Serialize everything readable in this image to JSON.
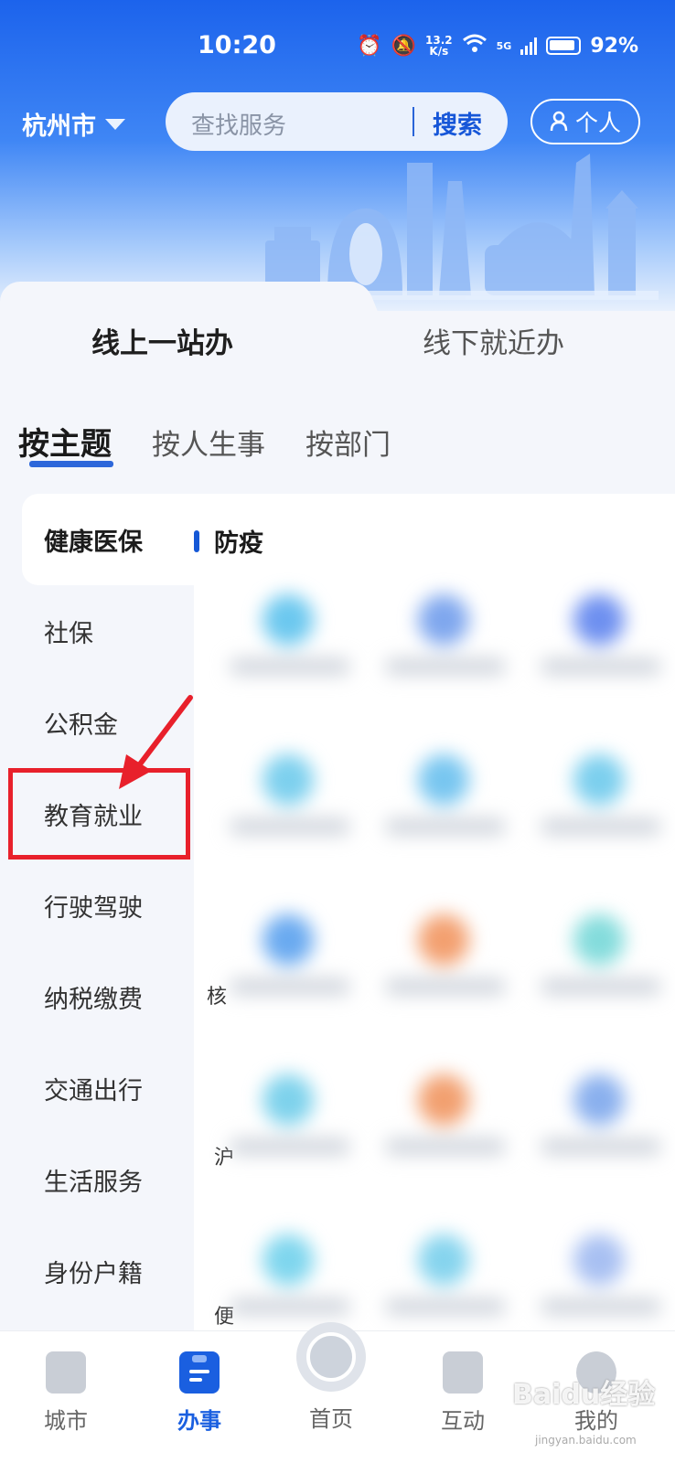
{
  "status_bar": {
    "time": "10:20",
    "speed_value": "13.2",
    "speed_unit": "K/s",
    "network": "5G",
    "battery": "92%"
  },
  "header": {
    "city": "杭州市",
    "search_placeholder": "查找服务",
    "search_button": "搜索",
    "personal_button": "个人"
  },
  "service_tabs": [
    {
      "label": "线上一站办",
      "active": true
    },
    {
      "label": "线下就近办",
      "active": false
    }
  ],
  "category_tabs": [
    {
      "label": "按主题",
      "active": true
    },
    {
      "label": "按人生事",
      "active": false
    },
    {
      "label": "按部门",
      "active": false
    }
  ],
  "side_menu": [
    {
      "label": "健康医保",
      "active": true
    },
    {
      "label": "社保"
    },
    {
      "label": "公积金"
    },
    {
      "label": "教育就业",
      "highlighted": true
    },
    {
      "label": "行驶驾驶"
    },
    {
      "label": "纳税缴费"
    },
    {
      "label": "交通出行"
    },
    {
      "label": "生活服务"
    },
    {
      "label": "身份户籍"
    }
  ],
  "content": {
    "section_title": "防疫",
    "partial_labels": [
      "核",
      "沪",
      "便"
    ]
  },
  "icon_colors": [
    "#6cc8ef",
    "#7fa7ee",
    "#6e90f0",
    "#7dd0ee",
    "#78c6f0",
    "#7ccfee",
    "#6aaaf0",
    "#f3a070",
    "#84dcdc",
    "#7ed2ec",
    "#f2a070",
    "#8ab0ee",
    "#7fd6ee",
    "#86d4ee",
    "#a8c0f2"
  ],
  "bottom_nav": [
    {
      "label": "城市",
      "icon": "city-icon",
      "active": false
    },
    {
      "label": "办事",
      "icon": "tasks-icon",
      "active": true
    },
    {
      "label": "首页",
      "icon": "home-icon",
      "active": false
    },
    {
      "label": "互动",
      "icon": "chat-icon",
      "active": false
    },
    {
      "label": "我的",
      "icon": "profile-icon",
      "active": false
    }
  ],
  "watermark": {
    "text": "Baidu经验",
    "sub": "jingyan.baidu.com"
  },
  "colors": {
    "primary": "#1a5fe0",
    "highlight": "#e8202b"
  }
}
